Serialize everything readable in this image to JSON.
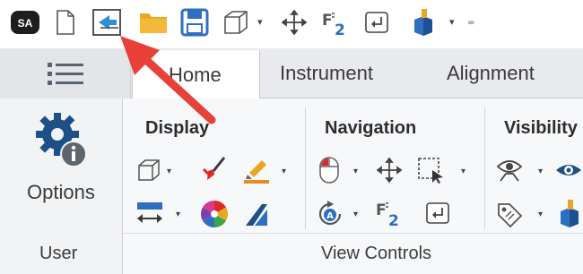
{
  "quick_access": {
    "app_badge": "SA",
    "icons": [
      "app-logo-icon",
      "new-file-icon",
      "import-export-icon",
      "open-folder-icon",
      "save-icon",
      "cube-view-icon",
      "move-icon",
      "f2-icon",
      "enter-icon",
      "instrument-icon"
    ]
  },
  "tabs": {
    "file_menu_icon": "list-menu-icon",
    "items": [
      {
        "label": "Home",
        "active": true
      },
      {
        "label": "Instrument",
        "active": false
      },
      {
        "label": "Alignment",
        "active": false
      }
    ]
  },
  "ribbon": {
    "user_group": {
      "button_label": "Options",
      "group_label": "User"
    },
    "view_controls": {
      "group_label": "View Controls",
      "display": {
        "label": "Display"
      },
      "navigation": {
        "label": "Navigation"
      },
      "visibility": {
        "label": "Visibility"
      }
    }
  },
  "annotation": {
    "arrow_color": "#e8413a"
  },
  "colors": {
    "accent_blue": "#2e6fc0",
    "folder": "#e9a824",
    "ribbon_bg": "#f7f8fa"
  }
}
